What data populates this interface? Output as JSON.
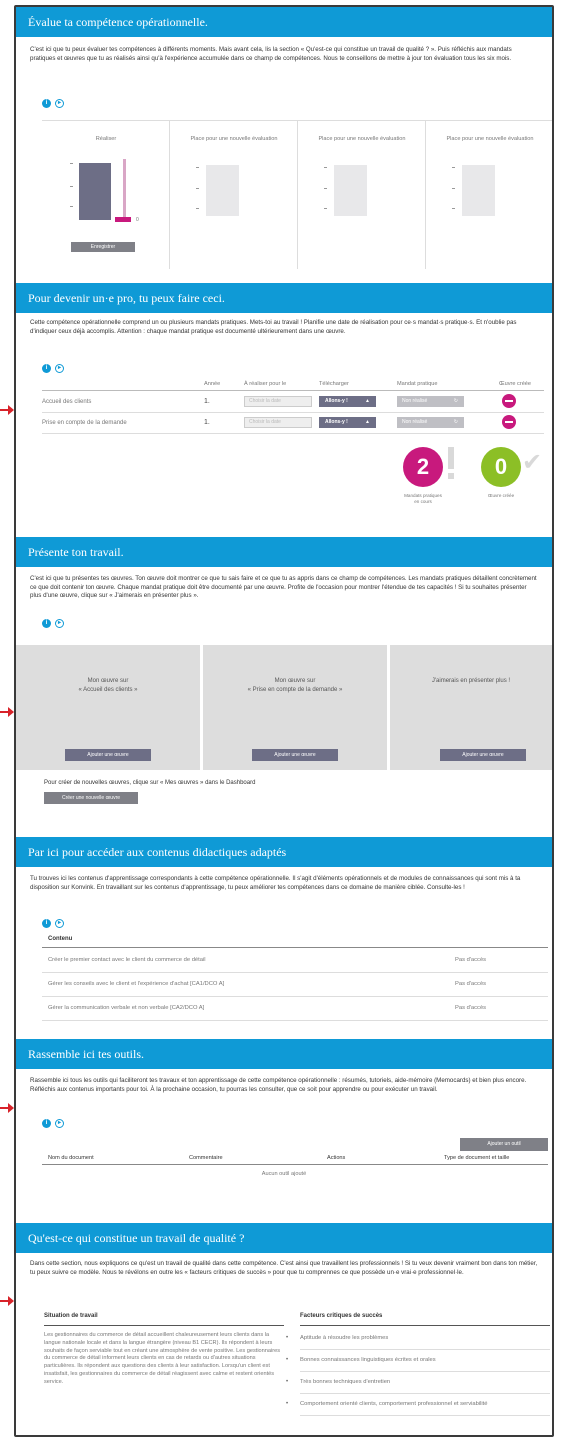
{
  "s1": {
    "title": "Évalue ta compétence opérationnelle.",
    "intro": "C'est ici que tu peux évaluer tes compétences à différents moments. Mais avant cela, lis la section « Qu'est-ce qui constitue un travail de qualité ? ». Puis réfléchis aux mandats pratiques et œuvres que tu as réalisés ainsi qu'à l'expérience accumulée dans ce champ de compétences. Nous te conseillons de mettre à jour ton évaluation tous les six mois.",
    "panels": [
      {
        "label": "Réaliser",
        "btn": "Enregistrer",
        "zero": "0"
      },
      {
        "label": "Place pour une nouvelle évaluation"
      },
      {
        "label": "Place pour une nouvelle évaluation"
      },
      {
        "label": "Place pour une nouvelle évaluation"
      }
    ]
  },
  "s2": {
    "title": "Pour devenir un·e pro, tu peux faire ceci.",
    "intro": "Cette compétence opérationnelle comprend un ou plusieurs mandats pratiques. Mets-toi au travail ! Planifie une date de réalisation pour ce·s mandat·s pratique·s. Et n'oublie pas d'indiquer ceux déjà accomplis. Attention : chaque mandat pratique est documenté ultérieurement dans une œuvre.",
    "headers": [
      "Année",
      "À réaliser pour le",
      "Télécharger",
      "Mandat pratique",
      "Œuvre créée"
    ],
    "rows": [
      {
        "name": "Accueil des clients",
        "year": "1.",
        "date": "Choisir la date",
        "dl": "Allons-y !",
        "status": "Non réalisé"
      },
      {
        "name": "Prise en compte de la demande",
        "year": "1.",
        "date": "Choisir la date",
        "dl": "Allons-y !",
        "status": "Non réalisé"
      }
    ],
    "stat1": {
      "num": "2",
      "label": "Mandats pratiques en cours"
    },
    "stat2": {
      "num": "0",
      "label": "Œuvre créée"
    }
  },
  "s3": {
    "title": "Présente ton travail.",
    "intro": "C'est ici que tu présentes tes œuvres. Ton œuvre doit montrer ce que tu sais faire et ce que tu as appris dans ce champ de compétences. Les mandats pratiques détaillent concrètement ce que doit contenir ton œuvre. Chaque mandat pratique doit être documenté par une œuvre. Profite de l'occasion pour montrer l'étendue de tes capacités ! Si tu souhaites présenter plus d'une œuvre, clique sur « J'aimerais en présenter plus ».",
    "cards": [
      {
        "l1": "Mon œuvre sur",
        "l2": "« Accueil des clients »",
        "btn": "Ajouter une œuvre"
      },
      {
        "l1": "Mon œuvre sur",
        "l2": "« Prise en compte de la demande »",
        "btn": "Ajouter une œuvre"
      },
      {
        "l1": "J'aimerais en présenter plus !",
        "l2": "",
        "btn": "Ajouter une œuvre"
      }
    ],
    "note": "Pour créer de nouvelles œuvres, clique sur « Mes œuvres » dans le Dashboard",
    "create": "Créer une nouvelle œuvre"
  },
  "s4": {
    "title": "Par ici pour accéder aux contenus didactiques adaptés",
    "intro": "Tu trouves ici les contenus d'apprentissage correspondants à cette compétence opérationnelle. Il s'agit d'éléments opérationnels et de modules de connaissances qui sont mis à ta disposition sur Konvink. En travaillant sur les contenus d'apprentissage, tu peux améliorer tes compétences dans ce domaine de manière ciblée. Consulte-les !",
    "header": "Contenu",
    "rows": [
      {
        "name": "Créer le premier contact avec le client du commerce de détail",
        "access": "Pas d'accès"
      },
      {
        "name": "Gérer les conseils avec le client et l'expérience d'achat [CA1/DCO A]",
        "access": "Pas d'accès"
      },
      {
        "name": "Gérer la communication verbale et non verbale [CA2/DCO A]",
        "access": "Pas d'accès"
      }
    ]
  },
  "s5": {
    "title": "Rassemble ici tes outils.",
    "intro": "Rassemble ici tous les outils qui faciliteront tes travaux et ton apprentissage de cette compétence opérationnelle : résumés, tutoriels, aide-mémoire (Memocards) et bien plus encore. Réfléchis aux contenus importants pour toi. À la prochaine occasion, tu pourras les consulter, que ce soit pour apprendre ou pour exécuter un travail.",
    "add": "Ajouter un outil",
    "headers": [
      "Nom du document",
      "Commentaire",
      "Actions",
      "Type de document et taille"
    ],
    "empty": "Aucun outil ajouté"
  },
  "s6": {
    "title": "Qu'est-ce qui constitue un travail de qualité ?",
    "intro": "Dans cette section, nous expliquons ce qu'est un travail de qualité dans cette compétence. C'est ainsi que travaillent les professionnels ! Si tu veux devenir vraiment bon dans ton métier, tu peux suivre ce modèle. Nous te révélons en outre les « facteurs critiques de succès » pour que tu comprennes ce que possède un·e vrai·e professionnel·le.",
    "col1": "Situation de travail",
    "col2": "Facteurs critiques de succès",
    "situation": "Les gestionnaires du commerce de détail accueillent chaleureusement leurs clients dans la langue nationale locale et dans la langue étrangère (niveau B1 CECR). Ils répondent à leurs souhaits de façon serviable tout en créant une atmosphère de vente positive. Les gestionnaires du commerce de détail informent leurs clients en cas de retards ou d'autres situations particulières. Ils répondent aux questions des clients à leur satisfaction. Lorsqu'un client est insatisfait, les gestionnaires du commerce de détail réagissent avec calme et restent orientés service.",
    "factors": [
      "Aptitude à résoudre les problèmes",
      "Bonnes connaissances linguistiques écrites et orales",
      "Très bonnes techniques d'entretien",
      "Comportement orienté clients, comportement professionnel et serviabilité"
    ]
  },
  "colors": {
    "band": "#0f9ad6",
    "magenta": "#c8197d",
    "green": "#8cbf26",
    "arrow": "#d8232a"
  }
}
